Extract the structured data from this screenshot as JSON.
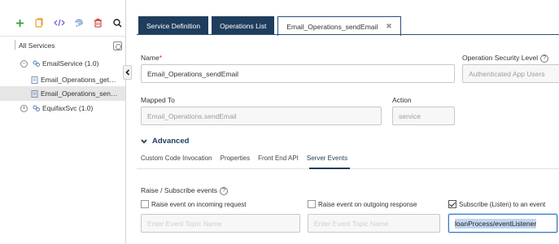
{
  "sidebar": {
    "toolbar": [
      {
        "name": "add-icon",
        "color": "#3aa03a"
      },
      {
        "name": "copy-icon",
        "color": "#e8a030"
      },
      {
        "name": "code-icon",
        "color": "#5a4fcf"
      },
      {
        "name": "fingerprint-icon",
        "color": "#4a7fc0"
      },
      {
        "name": "delete-icon",
        "color": "#c83232"
      },
      {
        "name": "search-icon",
        "color": "#222222"
      }
    ],
    "root_label": "All Services",
    "tree": [
      {
        "label": "EmailService (1.0)",
        "toggle": "−",
        "icon": "service-icon"
      },
      {
        "label": "Email_Operations_get…",
        "icon": "operation-icon"
      },
      {
        "label": "Email_Operations_sen…",
        "icon": "operation-icon",
        "selected": true
      },
      {
        "label": "EquifaxSvc (1.0)",
        "toggle": "+",
        "icon": "service-icon"
      }
    ]
  },
  "tabs": [
    {
      "label": "Service Definition"
    },
    {
      "label": "Operations List"
    },
    {
      "label": "Email_Operations_sendEmail",
      "close": "✖"
    }
  ],
  "form": {
    "name_label": "Name",
    "name_required": "*",
    "name_value": "Email_Operations_sendEmail",
    "security_label": "Operation Security Level",
    "security_help": "?",
    "security_value": "Authenticated App Users",
    "mapped_label": "Mapped To",
    "mapped_value": "Email_Operations.sendEmail",
    "action_label": "Action",
    "action_value": "service"
  },
  "advanced": {
    "label": "Advanced",
    "subtabs": [
      "Custom Code Invocation",
      "Properties",
      "Front End API",
      "Server Events"
    ],
    "active_subtab": "Server Events"
  },
  "events": {
    "section_label": "Raise / Subscribe events",
    "section_help": "?",
    "items": [
      {
        "label": "Raise event on incoming request",
        "checked": false,
        "placeholder": "Enter Event Topic Name",
        "value": ""
      },
      {
        "label": "Raise event on outgoing response",
        "checked": false,
        "placeholder": "Enter Event Topic Name",
        "value": ""
      },
      {
        "label": "Subscribe (Listen) to an event",
        "checked": true,
        "placeholder": "",
        "value": "loanProcess/eventListener"
      }
    ]
  },
  "colors": {
    "accent": "#1f3d5d",
    "tab_dark": "#1f3d5d",
    "focus": "#3a7bc8"
  }
}
